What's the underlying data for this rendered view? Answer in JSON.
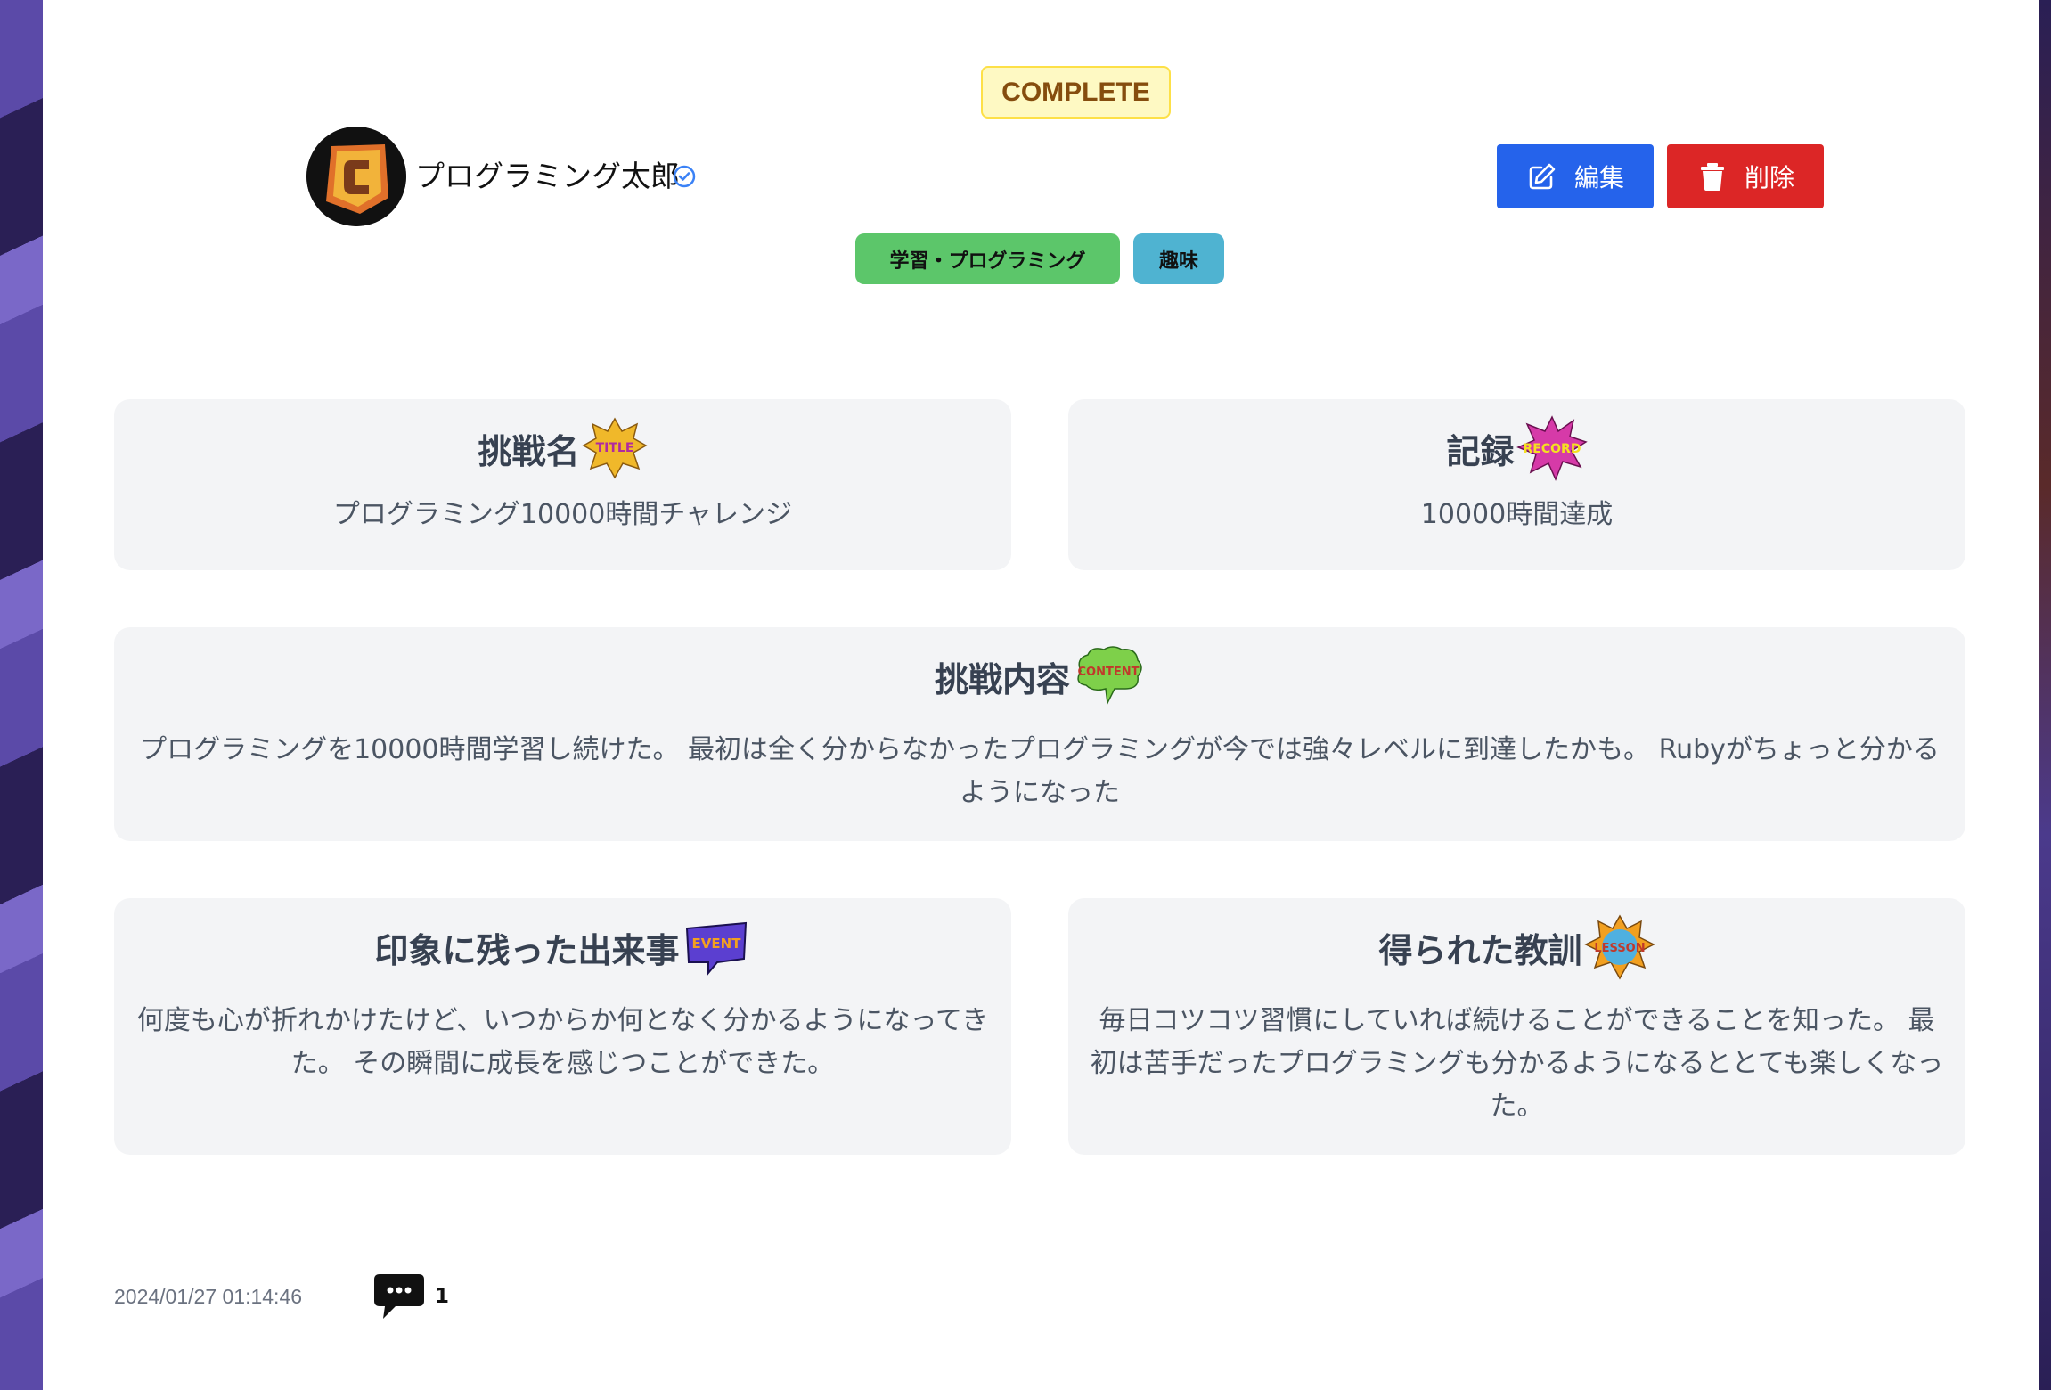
{
  "post": {
    "status": "COMPLETE",
    "user": {
      "name": "プログラミング太郎"
    },
    "actions": {
      "edit_label": "編集",
      "delete_label": "削除"
    },
    "tags": [
      "学習・プログラミング",
      "趣味"
    ],
    "sections": {
      "title": {
        "heading": "挑戦名",
        "sticker": "TITLE",
        "body": "プログラミング10000時間チャレンジ"
      },
      "record": {
        "heading": "記録",
        "sticker": "RECORD",
        "body": "10000時間達成"
      },
      "content": {
        "heading": "挑戦内容",
        "sticker": "CONTENT",
        "body": "プログラミングを10000時間学習し続けた。 最初は全く分からなかったプログラミングが今では強々レベルに到達したかも。 Rubyがちょっと分かるようになった"
      },
      "event": {
        "heading": "印象に残った出来事",
        "sticker": "EVENT",
        "body": "何度も心が折れかけたけど、いつからか何となく分かるようになってきた。 その瞬間に成長を感じつことができた。"
      },
      "lesson": {
        "heading": "得られた教訓",
        "sticker": "LESSON",
        "body": "毎日コツコツ習慣にしていれば続けることができることを知った。 最初は苦手だったプログラミングも分かるようになるととても楽しくなった。"
      }
    },
    "footer": {
      "timestamp": "2024/01/27 01:14:46",
      "comment_count": "1"
    }
  },
  "colors": {
    "edit_button": "#2563eb",
    "delete_button": "#dc2626",
    "tag_study": "#5cc66a",
    "tag_hobby": "#4fb3d1",
    "status_bg": "#fef9c3",
    "status_text": "#854d0e"
  },
  "icons": [
    "avatar-logo-icon",
    "verified-icon",
    "edit-icon",
    "trash-icon",
    "comment-icon"
  ]
}
